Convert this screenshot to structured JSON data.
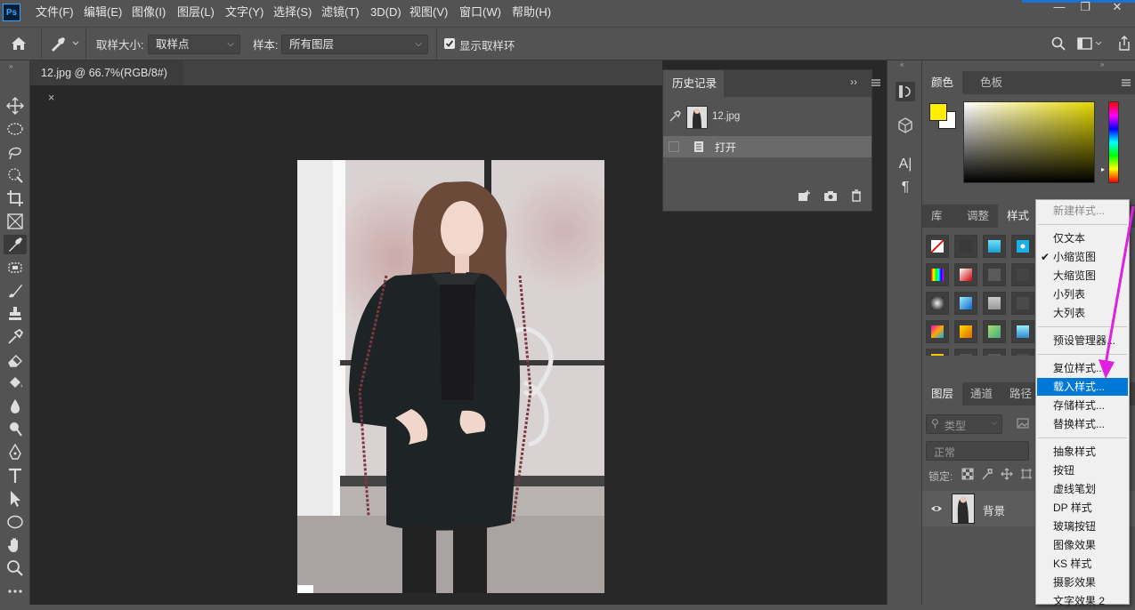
{
  "app": {
    "logo": "Ps"
  },
  "menu": [
    "文件(F)",
    "编辑(E)",
    "图像(I)",
    "图层(L)",
    "文字(Y)",
    "选择(S)",
    "滤镜(T)",
    "3D(D)",
    "视图(V)",
    "窗口(W)",
    "帮助(H)"
  ],
  "window_controls": {
    "minimize": "—",
    "restore": "❐",
    "close": "✕"
  },
  "options": {
    "sample_size_label": "取样大小:",
    "sample_size_value": "取样点",
    "sample_label": "样本:",
    "sample_value": "所有图层",
    "show_ring_label": "显示取样环",
    "show_ring_checked": true
  },
  "document": {
    "tab_title": "12.jpg @ 66.7%(RGB/8#)",
    "close": "×"
  },
  "history": {
    "title": "历史记录",
    "snapshot_name": "12.jpg",
    "steps": [
      "打开"
    ]
  },
  "color_panel": {
    "tabs": [
      "颜色",
      "色板"
    ],
    "foreground": "#ffee00",
    "background": "#ffffff",
    "hue_base": "#e5d800"
  },
  "styles_panel": {
    "tabs": [
      "库",
      "调整",
      "样式"
    ]
  },
  "layers_panel": {
    "tabs": [
      "图层",
      "通道",
      "路径"
    ],
    "filter_placeholder": "类型",
    "blend_mode": "正常",
    "lock_label": "锁定:",
    "layer_name": "背景"
  },
  "context_menu": {
    "items": [
      {
        "label": "新建样式...",
        "disabled": true
      },
      {
        "sep": true
      },
      {
        "label": "仅文本"
      },
      {
        "label": "小缩览图",
        "checked": true
      },
      {
        "label": "大缩览图"
      },
      {
        "label": "小列表"
      },
      {
        "label": "大列表"
      },
      {
        "sep": true
      },
      {
        "label": "预设管理器..."
      },
      {
        "sep": true
      },
      {
        "label": "复位样式..."
      },
      {
        "label": "载入样式...",
        "highlighted": true
      },
      {
        "label": "存储样式..."
      },
      {
        "label": "替换样式..."
      },
      {
        "sep": true
      },
      {
        "label": "抽象样式"
      },
      {
        "label": "按钮"
      },
      {
        "label": "虚线笔划"
      },
      {
        "label": "DP 样式"
      },
      {
        "label": "玻璃按钮"
      },
      {
        "label": "图像效果"
      },
      {
        "label": "KS 样式"
      },
      {
        "label": "摄影效果"
      },
      {
        "label": "文字效果 2"
      }
    ]
  },
  "colors": {
    "annotation_arrow": "#e020e0",
    "menu_highlight": "#0078d7"
  },
  "icons": {
    "tools": [
      "move-icon",
      "marquee-icon",
      "lasso-icon",
      "quick-select-icon",
      "crop-icon",
      "frame-icon",
      "eyedropper-icon",
      "patch-icon",
      "brush-icon",
      "stamp-icon",
      "history-brush-icon",
      "eraser-icon",
      "paint-bucket-icon",
      "blur-icon",
      "dodge-icon",
      "pen-icon",
      "type-icon",
      "path-select-icon",
      "ellipse-icon",
      "hand-icon",
      "zoom-icon",
      "more-icon"
    ]
  }
}
